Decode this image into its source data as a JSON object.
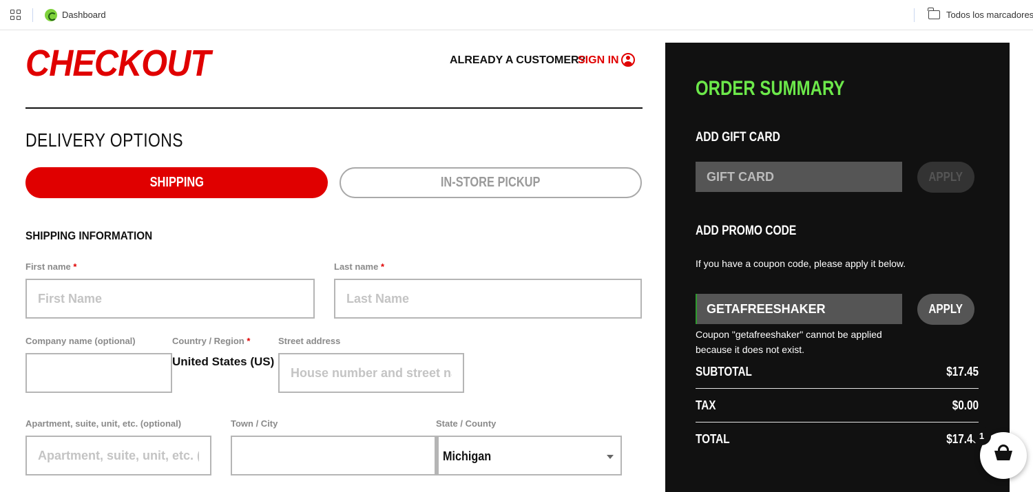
{
  "browser": {
    "bookmark_dashboard": "Dashboard",
    "all_bookmarks": "Todos los marcadores"
  },
  "header": {
    "title": "CHECKOUT",
    "already_customer": "ALREADY A CUSTOMER?",
    "sign_in": "SIGN IN"
  },
  "delivery": {
    "title": "DELIVERY OPTIONS",
    "shipping_label": "SHIPPING",
    "pickup_label": "IN-STORE PICKUP",
    "selected": "SHIPPING"
  },
  "shipping_info": {
    "title": "SHIPPING INFORMATION",
    "required_mark": "*",
    "first_name": {
      "label": "First name",
      "placeholder": "First Name",
      "value": ""
    },
    "last_name": {
      "label": "Last name",
      "placeholder": "Last Name",
      "value": ""
    },
    "company": {
      "label": "Company name (optional)",
      "value": ""
    },
    "country": {
      "label": "Country / Region",
      "value": "United States (US)"
    },
    "street": {
      "label": "Street address",
      "placeholder": "House number and street name",
      "value": ""
    },
    "apartment": {
      "label": "Apartment, suite, unit, etc. (optional)",
      "placeholder": "Apartment, suite, unit, etc. (optional)",
      "value": ""
    },
    "city": {
      "label": "Town / City",
      "value": ""
    },
    "state": {
      "label": "State / County",
      "value": "Michigan"
    }
  },
  "summary": {
    "title": "ORDER SUMMARY",
    "title_color": "#6ce84a",
    "gift_card": {
      "heading": "ADD GIFT CARD",
      "placeholder": "GIFT CARD",
      "apply": "APPLY"
    },
    "promo": {
      "heading": "ADD PROMO CODE",
      "note": "If you have a coupon code, please apply it below.",
      "value": "GETAFREESHAKER",
      "apply": "APPLY",
      "error": "Coupon \"getafreeshaker\" cannot be applied because it does not exist."
    },
    "subtotal_label": "SUBTOTAL",
    "subtotal_value": "$17.45",
    "tax_label": "TAX",
    "tax_value": "$0.00",
    "total_label": "TOTAL",
    "total_value": "$17.45"
  },
  "cart": {
    "count": "1"
  },
  "colors": {
    "brand_red": "#e00000",
    "summary_bg": "#111111"
  }
}
